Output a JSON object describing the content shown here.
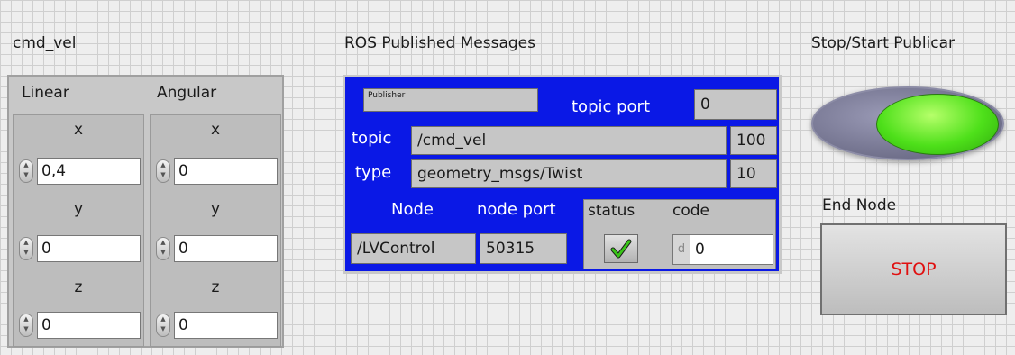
{
  "cmd_vel": {
    "title": "cmd_vel",
    "linear": {
      "label": "Linear",
      "x_label": "x",
      "x": "0,4",
      "y_label": "y",
      "y": "0",
      "z_label": "z",
      "z": "0"
    },
    "angular": {
      "label": "Angular",
      "x_label": "x",
      "x": "0",
      "y_label": "y",
      "y": "0",
      "z_label": "z",
      "z": "0"
    }
  },
  "ros": {
    "title": "ROS Published Messages",
    "publisher_caption": "Publisher",
    "topic_port_label": "topic port",
    "topic_port": "0",
    "topic_label": "topic",
    "topic": "/cmd_vel",
    "topic_queue": "100",
    "type_label": "type",
    "type": "geometry_msgs/Twist",
    "type_queue": "10",
    "node_label": "Node",
    "node": "/LVControl",
    "node_port_label": "node port",
    "node_port": "50315",
    "status_label": "status",
    "code_label": "code",
    "code_radix": "d",
    "code": "0"
  },
  "controls": {
    "toggle_label": "Stop/Start Publicar",
    "end_label": "End Node",
    "stop_label": "STOP"
  },
  "colors": {
    "cluster_blue": "#0a18e6",
    "led_green": "#4ee01a",
    "stop_red": "#e01010"
  },
  "icons": {
    "status": "check-icon",
    "spinners": "increment-decrement-icon"
  }
}
